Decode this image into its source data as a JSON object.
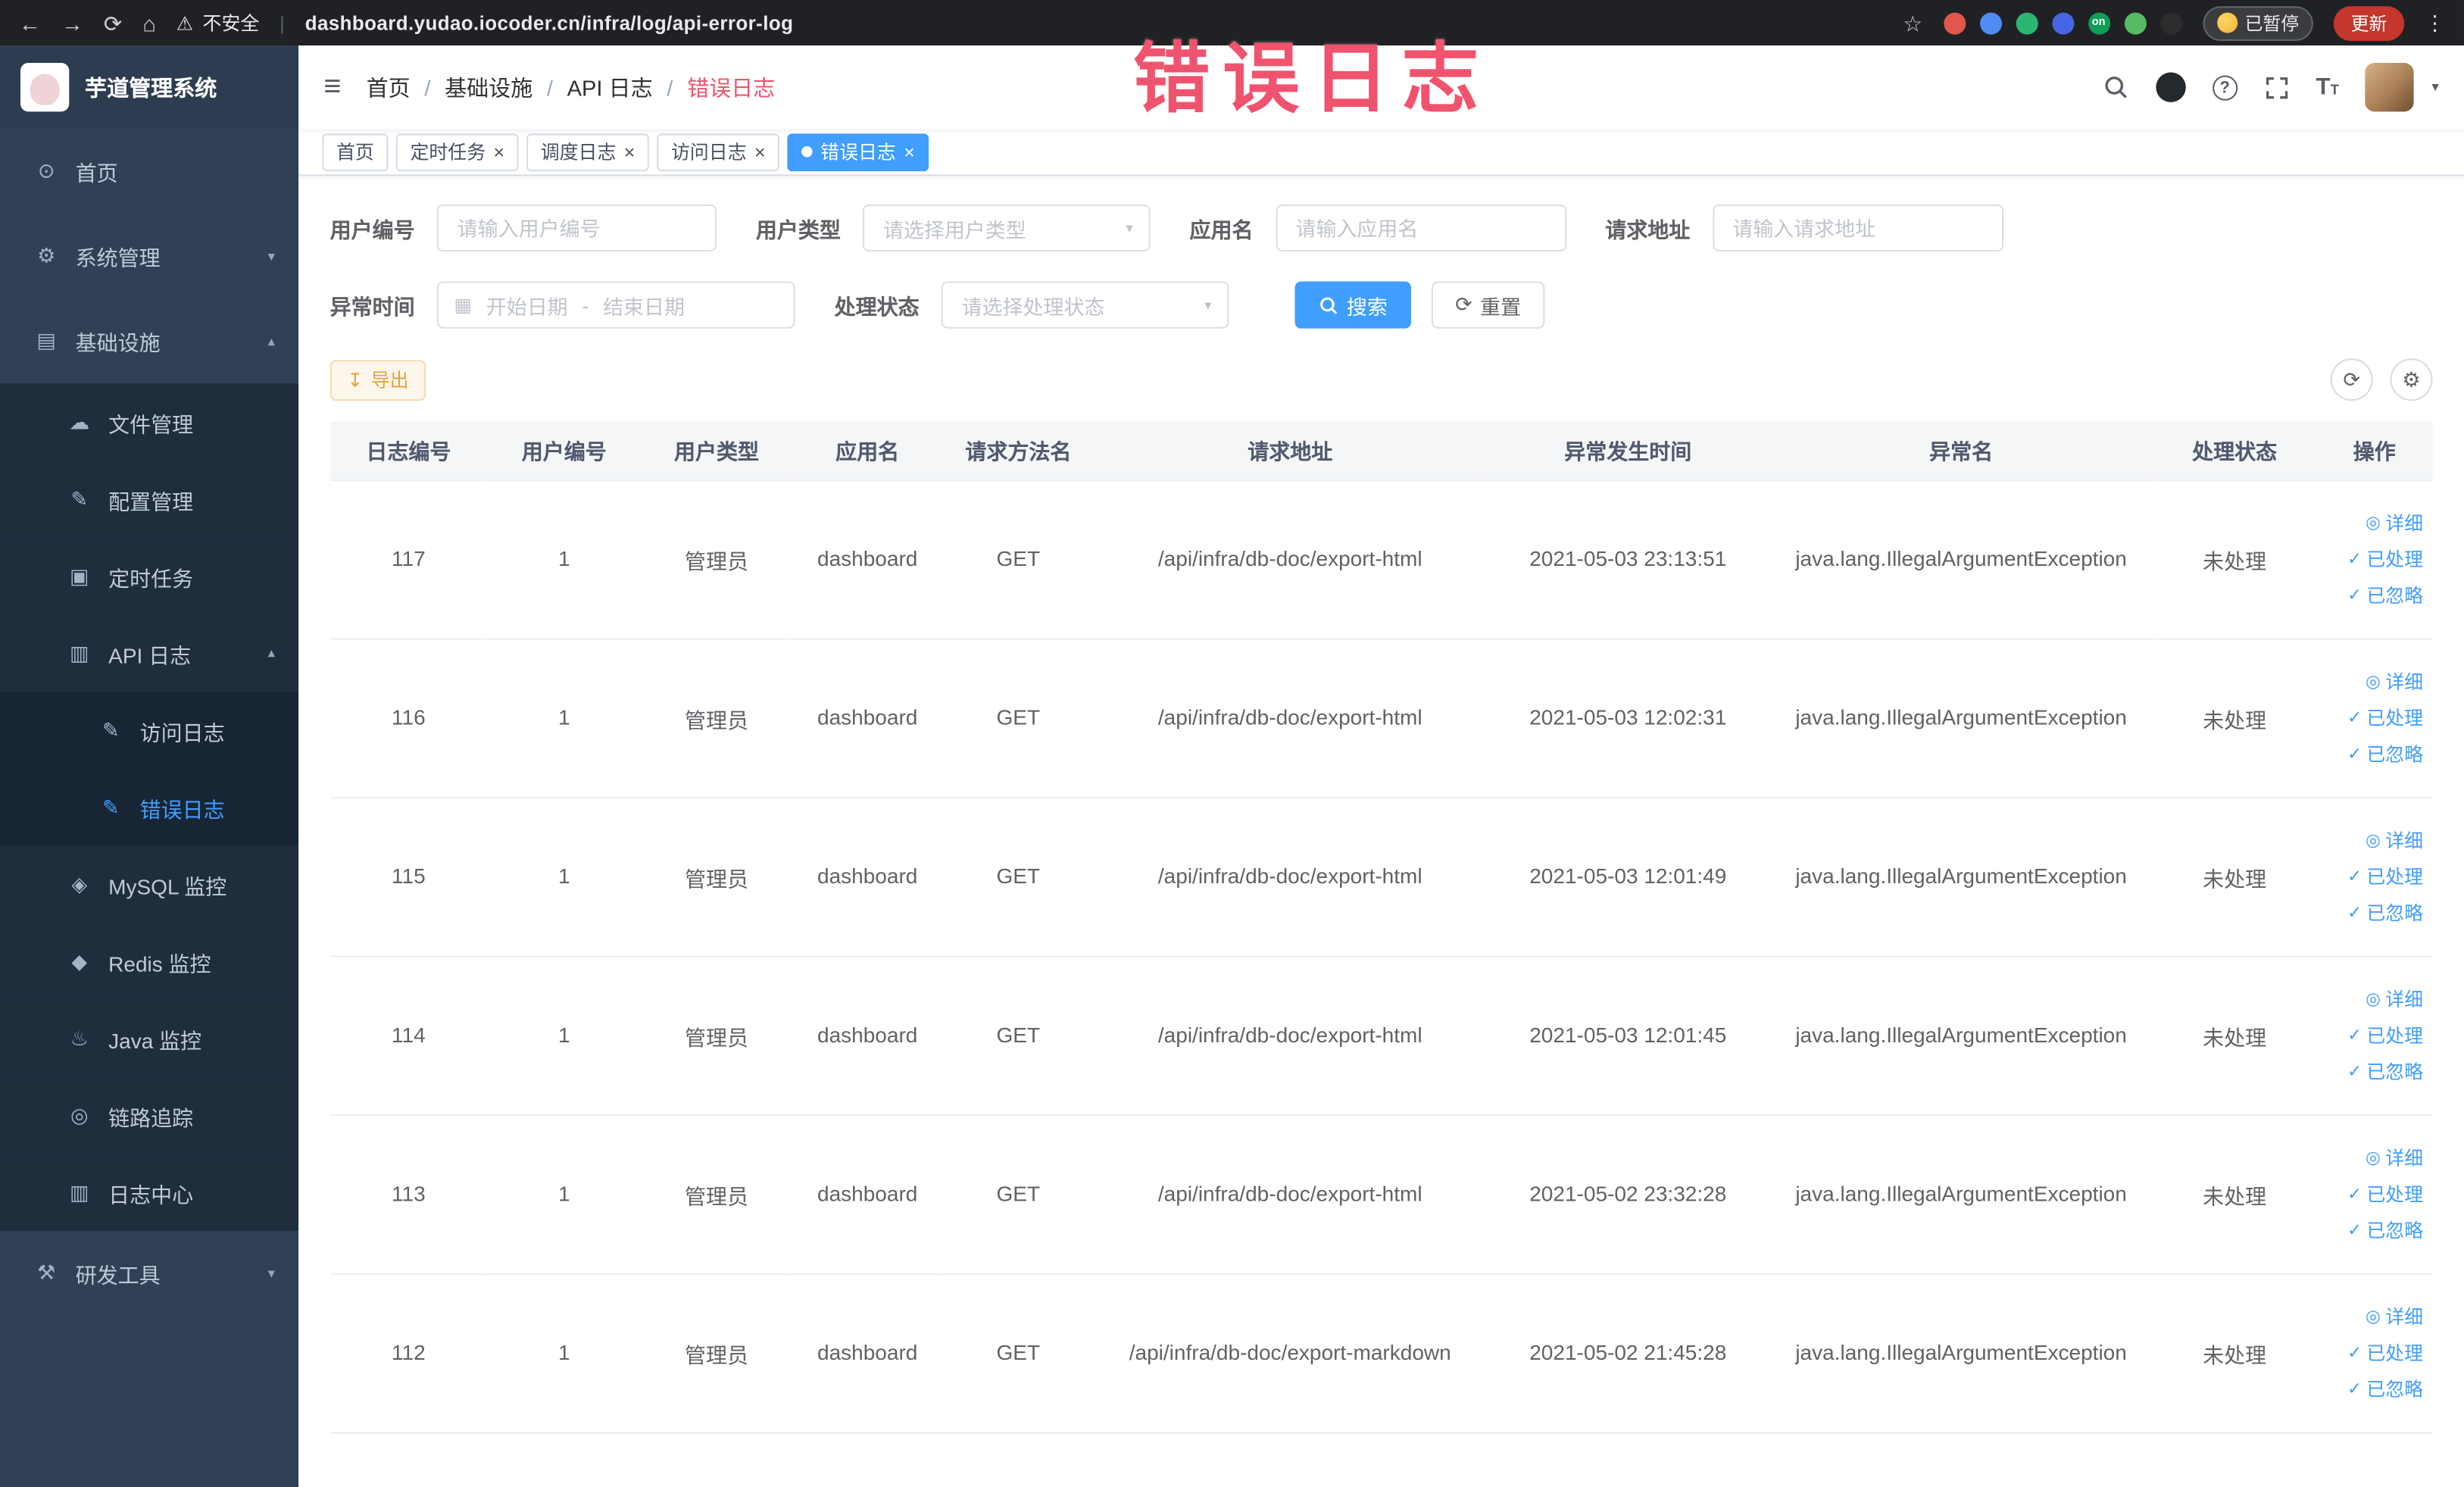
{
  "browser": {
    "security_label": "不安全",
    "url": "dashboard.yudao.iocoder.cn/infra/log/api-error-log",
    "paused_badge": "已暂停",
    "update_button": "更新",
    "extensions": [
      {
        "color": "#e2574c"
      },
      {
        "color": "#4f8df5"
      },
      {
        "color": "#2bb673"
      },
      {
        "color": "#4666e5"
      },
      {
        "color": "#0f9d58",
        "label": "on"
      },
      {
        "color": "#57bb63"
      },
      {
        "color": "#2d2d2d"
      }
    ]
  },
  "annotation": {
    "title": "错误日志",
    "color": "#f0536d"
  },
  "app": {
    "logo_title": "芋道管理系统"
  },
  "icons": {
    "back": "←",
    "forward": "→",
    "reload": "⟳",
    "home": "⌂",
    "warning": "⚠",
    "divider": "|",
    "star": "☆",
    "more": "⋮",
    "menu": "≡",
    "caret_down": "▾",
    "caret_up": "▴",
    "close": "×",
    "calendar": "▦",
    "refresh": "⟳",
    "settings": "⚙",
    "download": "↧",
    "question": "?",
    "font_size": "T"
  },
  "sidebar": {
    "items": [
      {
        "id": "home",
        "label": "首页",
        "icon": "dashboard-icon",
        "glyph": "⊙",
        "level": 1
      },
      {
        "id": "system-management",
        "label": "系统管理",
        "icon": "gear-icon",
        "glyph": "⚙",
        "level": 1,
        "chevron": "down",
        "chevron_glyph": "▾"
      },
      {
        "id": "infrastructure",
        "label": "基础设施",
        "icon": "infrastructure-icon",
        "glyph": "▤",
        "level": 1,
        "chevron": "up",
        "chevron_glyph": "▴"
      },
      {
        "id": "file-management",
        "label": "文件管理",
        "icon": "cloud-icon",
        "glyph": "☁",
        "level": 2
      },
      {
        "id": "config-management",
        "label": "配置管理",
        "icon": "edit-icon",
        "glyph": "✎",
        "level": 2
      },
      {
        "id": "scheduled-tasks",
        "label": "定时任务",
        "icon": "task-icon",
        "glyph": "▣",
        "level": 2
      },
      {
        "id": "api-log",
        "label": "API 日志",
        "icon": "api-log-icon",
        "glyph": "▥",
        "level": 2,
        "chevron": "up",
        "chevron_glyph": "▴"
      },
      {
        "id": "access-log",
        "label": "访问日志",
        "icon": "access-log-icon",
        "glyph": "✎",
        "level": 3
      },
      {
        "id": "error-log",
        "label": "错误日志",
        "icon": "error-log-icon",
        "glyph": "✎",
        "level": 3,
        "active": true
      },
      {
        "id": "mysql-monitor",
        "label": "MySQL 监控",
        "icon": "mysql-icon",
        "glyph": "◈",
        "level": 2
      },
      {
        "id": "redis-monitor",
        "label": "Redis 监控",
        "icon": "redis-icon",
        "glyph": "◆",
        "level": 2
      },
      {
        "id": "java-monitor",
        "label": "Java 监控",
        "icon": "java-icon",
        "glyph": "♨",
        "level": 2
      },
      {
        "id": "link-tracing",
        "label": "链路追踪",
        "icon": "trace-icon",
        "glyph": "◎",
        "level": 2
      },
      {
        "id": "log-center",
        "label": "日志中心",
        "icon": "log-center-icon",
        "glyph": "▥",
        "level": 2
      },
      {
        "id": "dev-tools",
        "label": "研发工具",
        "icon": "tools-icon",
        "glyph": "⚒",
        "level": 1,
        "chevron": "down",
        "chevron_glyph": "▾"
      }
    ]
  },
  "header": {
    "breadcrumb": [
      "首页",
      "基础设施",
      "API 日志",
      "错误日志"
    ],
    "separator": "/"
  },
  "tabs": [
    {
      "id": "home",
      "label": "首页",
      "closable": false,
      "active": false
    },
    {
      "id": "scheduled-tasks",
      "label": "定时任务",
      "closable": true,
      "active": false
    },
    {
      "id": "schedule-log",
      "label": "调度日志",
      "closable": true,
      "active": false
    },
    {
      "id": "access-log",
      "label": "访问日志",
      "closable": true,
      "active": false
    },
    {
      "id": "error-log",
      "label": "错误日志",
      "closable": true,
      "active": true
    }
  ],
  "filters": {
    "user_id": {
      "label": "用户编号",
      "placeholder": "请输入用户编号"
    },
    "user_type": {
      "label": "用户类型",
      "placeholder": "请选择用户类型"
    },
    "app_name": {
      "label": "应用名",
      "placeholder": "请输入应用名"
    },
    "request_url": {
      "label": "请求地址",
      "placeholder": "请输入请求地址"
    },
    "exception_time": {
      "label": "异常时间",
      "start_placeholder": "开始日期",
      "separator": "-",
      "end_placeholder": "结束日期"
    },
    "process_status": {
      "label": "处理状态",
      "placeholder": "请选择处理状态"
    },
    "search_button": "搜索",
    "reset_button": "重置"
  },
  "toolbar": {
    "export_button": "导出"
  },
  "table": {
    "columns": [
      "日志编号",
      "用户编号",
      "用户类型",
      "应用名",
      "请求方法名",
      "请求地址",
      "异常发生时间",
      "异常名",
      "处理状态",
      "操作"
    ],
    "rows": [
      {
        "log_id": "117",
        "user_id": "1",
        "user_type": "管理员",
        "app_name": "dashboard",
        "method": "GET",
        "url": "/api/infra/db-doc/export-html",
        "time": "2021-05-03 23:13:51",
        "exception": "java.lang.IllegalArgumentException",
        "status": "未处理"
      },
      {
        "log_id": "116",
        "user_id": "1",
        "user_type": "管理员",
        "app_name": "dashboard",
        "method": "GET",
        "url": "/api/infra/db-doc/export-html",
        "time": "2021-05-03 12:02:31",
        "exception": "java.lang.IllegalArgumentException",
        "status": "未处理"
      },
      {
        "log_id": "115",
        "user_id": "1",
        "user_type": "管理员",
        "app_name": "dashboard",
        "method": "GET",
        "url": "/api/infra/db-doc/export-html",
        "time": "2021-05-03 12:01:49",
        "exception": "java.lang.IllegalArgumentException",
        "status": "未处理"
      },
      {
        "log_id": "114",
        "user_id": "1",
        "user_type": "管理员",
        "app_name": "dashboard",
        "method": "GET",
        "url": "/api/infra/db-doc/export-html",
        "time": "2021-05-03 12:01:45",
        "exception": "java.lang.IllegalArgumentException",
        "status": "未处理"
      },
      {
        "log_id": "113",
        "user_id": "1",
        "user_type": "管理员",
        "app_name": "dashboard",
        "method": "GET",
        "url": "/api/infra/db-doc/export-html",
        "time": "2021-05-02 23:32:28",
        "exception": "java.lang.IllegalArgumentException",
        "status": "未处理"
      },
      {
        "log_id": "112",
        "user_id": "1",
        "user_type": "管理员",
        "app_name": "dashboard",
        "method": "GET",
        "url": "/api/infra/db-doc/export-markdown",
        "time": "2021-05-02 21:45:28",
        "exception": "java.lang.IllegalArgumentException",
        "status": "未处理"
      }
    ],
    "row_actions": [
      {
        "id": "detail",
        "icon": "eye-icon",
        "glyph": "◎",
        "label": "详细"
      },
      {
        "id": "processed",
        "icon": "check-icon",
        "glyph": "✓",
        "label": "已处理"
      },
      {
        "id": "ignored",
        "icon": "check-icon",
        "glyph": "✓",
        "label": "已忽略"
      }
    ]
  },
  "colors": {
    "accent": "#409eff",
    "sidebar_bg": "#304156",
    "submenu_bg": "#1f2d3d",
    "annotation": "#f0536d",
    "warning_text": "#e6a23c",
    "table_header_bg": "#f5f6f8"
  }
}
